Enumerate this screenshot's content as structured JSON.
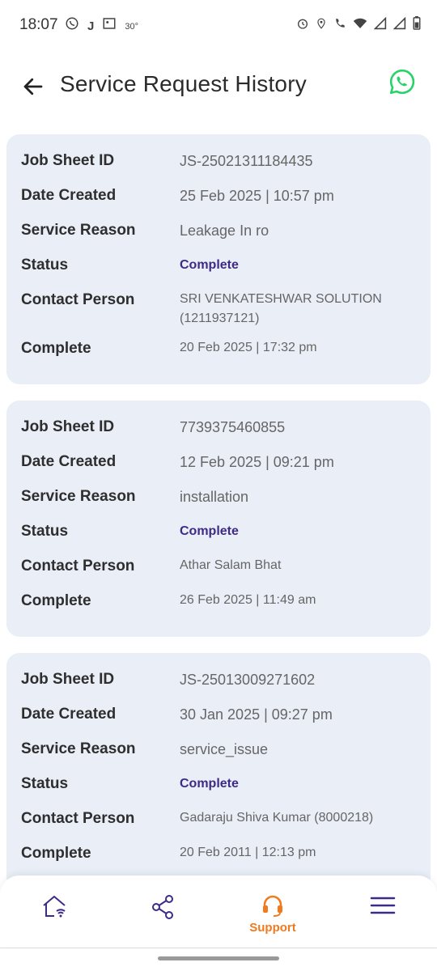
{
  "status_bar": {
    "time": "18:07",
    "left_icons": [
      "whatsapp-icon",
      "j-app-icon",
      "gallery-icon"
    ],
    "j_glyph": "J",
    "temperature": "30°",
    "right_icons": [
      "alarm-icon",
      "location-icon",
      "wifi-call-icon",
      "wifi-icon",
      "signal-icon",
      "signal-icon",
      "battery-icon"
    ]
  },
  "header": {
    "title": "Service Request History",
    "back_icon": "arrow-left-icon",
    "action_icon": "whatsapp-icon",
    "whatsapp_color": "#25d366"
  },
  "labels": {
    "job_sheet_id": "Job Sheet ID",
    "date_created": "Date Created",
    "service_reason": "Service Reason",
    "status": "Status",
    "contact_person": "Contact Person",
    "complete": "Complete"
  },
  "requests": [
    {
      "job_sheet_id": "JS-25021311184435",
      "date_created": "25 Feb 2025 | 10:57 pm",
      "service_reason": "Leakage In ro",
      "status": "Complete",
      "contact_person": "SRI VENKATESHWAR SOLUTION (1211937121)",
      "complete": "20 Feb 2025 | 17:32 pm"
    },
    {
      "job_sheet_id": "7739375460855",
      "date_created": "12 Feb 2025 | 09:21 pm",
      "service_reason": "installation",
      "status": "Complete",
      "contact_person": "Athar Salam Bhat",
      "complete": "26 Feb 2025 | 11:49 am"
    },
    {
      "job_sheet_id": "JS-25013009271602",
      "date_created": "30 Jan 2025 | 09:27 pm",
      "service_reason": "service_issue",
      "status": "Complete",
      "contact_person": "Gadaraju Shiva Kumar (8000218)",
      "complete": "20 Feb 2011 | 12:13 pm"
    }
  ],
  "bottom_nav": {
    "items": [
      {
        "icon": "home-wifi-icon",
        "label": ""
      },
      {
        "icon": "share-icon",
        "label": ""
      },
      {
        "icon": "headset-icon",
        "label": "Support",
        "active": true
      },
      {
        "icon": "menu-icon",
        "label": ""
      }
    ],
    "active_color": "#f07a1e",
    "icon_color": "#3e2a87"
  },
  "colors": {
    "card_bg": "#e9eef7",
    "status_text": "#3e2a87"
  }
}
